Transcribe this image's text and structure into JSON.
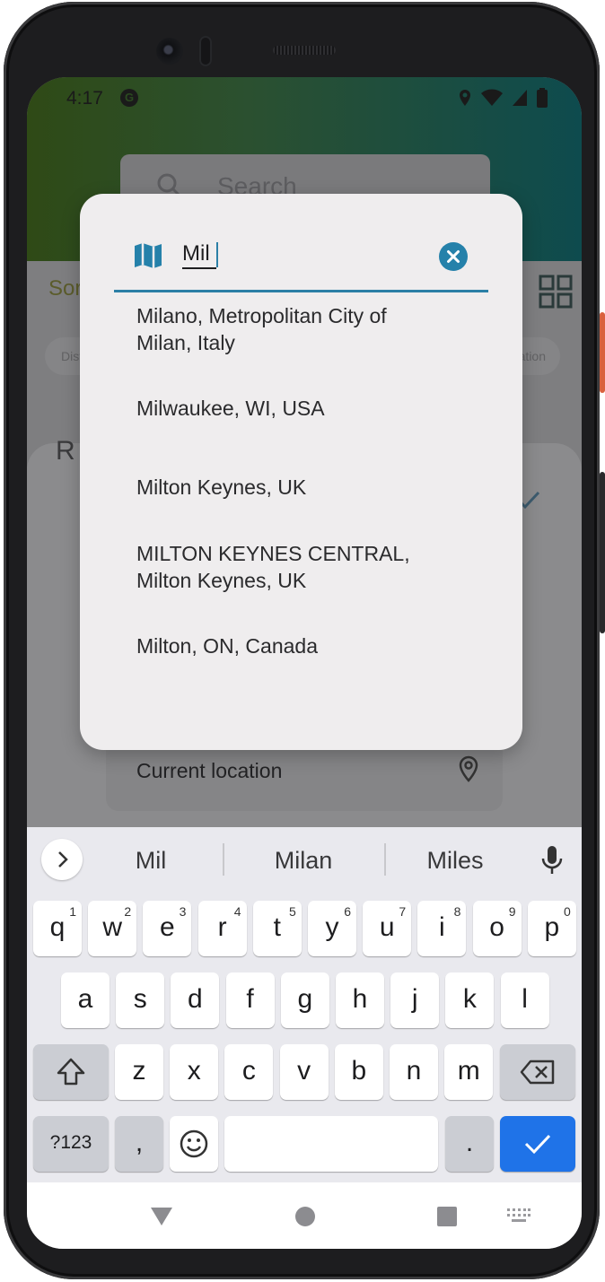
{
  "status_bar": {
    "time": "4:17",
    "app_badge": "G"
  },
  "background_app": {
    "search_placeholder": "Search",
    "sort_label": "Sort",
    "chip_left": "Dista",
    "chip_right": "ation",
    "sheet_heading_initial": "R",
    "current_location_label": "Current location"
  },
  "dialog": {
    "input_value": "Mil",
    "suggestions": [
      {
        "line1": "Milano, Metropolitan City of",
        "line2": "Milan, Italy"
      },
      {
        "line1": "Milwaukee, WI, USA",
        "line2": ""
      },
      {
        "line1": "Milton Keynes, UK",
        "line2": ""
      },
      {
        "line1": "MILTON KEYNES CENTRAL,",
        "line2": "Milton Keynes, UK"
      },
      {
        "line1": "Milton, ON, Canada",
        "line2": ""
      }
    ]
  },
  "keyboard": {
    "suggestions": [
      "Mil",
      "Milan",
      "Miles"
    ],
    "row1": [
      {
        "k": "q",
        "n": "1"
      },
      {
        "k": "w",
        "n": "2"
      },
      {
        "k": "e",
        "n": "3"
      },
      {
        "k": "r",
        "n": "4"
      },
      {
        "k": "t",
        "n": "5"
      },
      {
        "k": "y",
        "n": "6"
      },
      {
        "k": "u",
        "n": "7"
      },
      {
        "k": "i",
        "n": "8"
      },
      {
        "k": "o",
        "n": "9"
      },
      {
        "k": "p",
        "n": "0"
      }
    ],
    "row2": [
      "a",
      "s",
      "d",
      "f",
      "g",
      "h",
      "j",
      "k",
      "l"
    ],
    "row3": [
      "z",
      "x",
      "c",
      "v",
      "b",
      "n",
      "m"
    ],
    "symbols_key": "?123",
    "comma_key": ",",
    "period_key": ".",
    "accent_color": "#1f73e8"
  },
  "icons": {
    "dialog_leading": "map-icon",
    "dialog_trailing": "clear-icon",
    "keyboard_expand": "chevron-right-icon",
    "keyboard_mic": "mic-icon",
    "shift": "shift-icon",
    "backspace": "backspace-icon",
    "emoji": "emoji-icon",
    "enter": "check-icon"
  },
  "colors": {
    "dialog_accent": "#2581aa",
    "dialog_background": "#efedee"
  }
}
